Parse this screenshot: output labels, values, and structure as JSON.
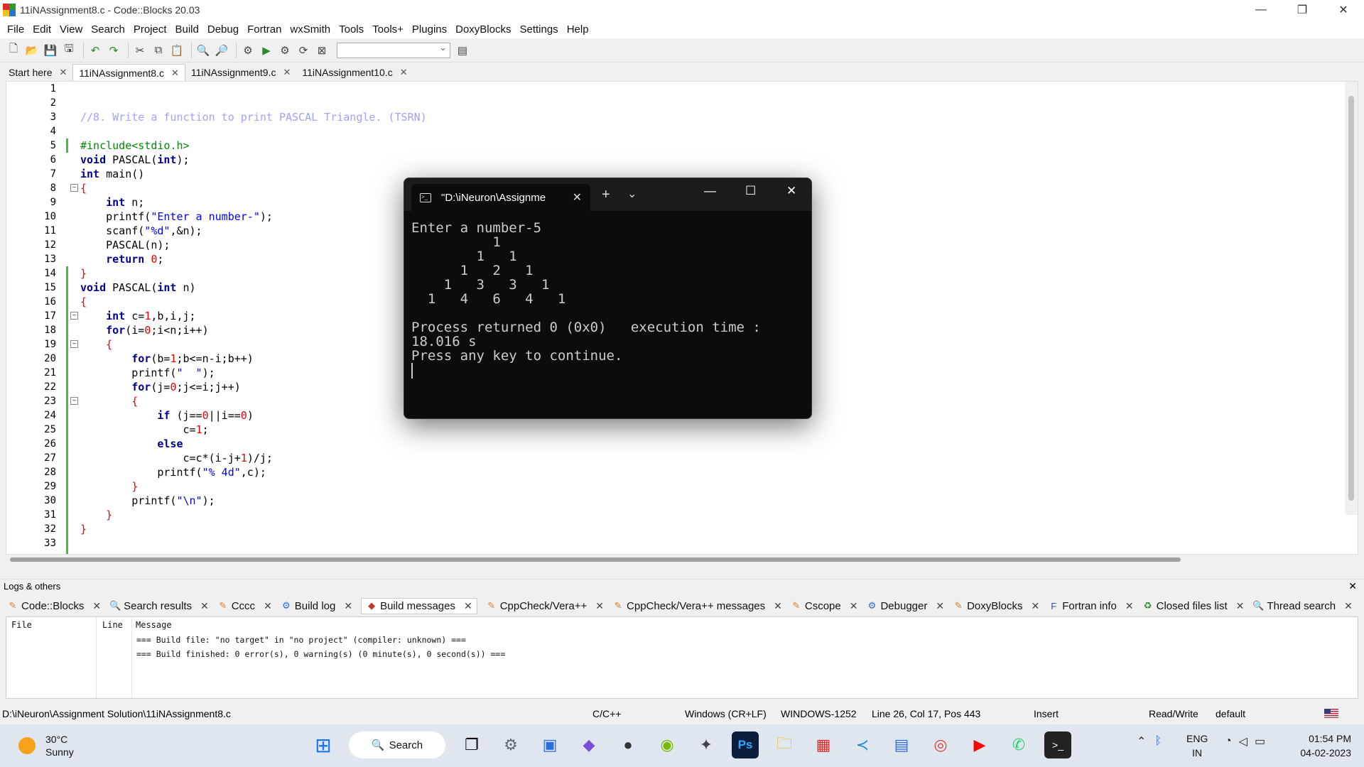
{
  "window": {
    "title": "11iNAssignment8.c - Code::Blocks 20.03",
    "minimize": "—",
    "maximize": "❐",
    "close": "✕"
  },
  "menu": [
    "File",
    "Edit",
    "View",
    "Search",
    "Project",
    "Build",
    "Debug",
    "Fortran",
    "wxSmith",
    "Tools",
    "Tools+",
    "Plugins",
    "DoxyBlocks",
    "Settings",
    "Help"
  ],
  "tabs": [
    {
      "label": "Start here",
      "close": "✕"
    },
    {
      "label": "11iNAssignment8.c",
      "close": "✕"
    },
    {
      "label": "11iNAssignment9.c",
      "close": "✕"
    },
    {
      "label": "11iNAssignment10.c",
      "close": "✕"
    }
  ],
  "editor": {
    "line_numbers": [
      "1",
      "2",
      "3",
      "4",
      "5",
      "6",
      "7",
      "8",
      "9",
      "10",
      "11",
      "12",
      "13",
      "14",
      "15",
      "16",
      "17",
      "18",
      "19",
      "20",
      "21",
      "22",
      "23",
      "24",
      "25",
      "26",
      "27",
      "28",
      "29",
      "30",
      "31",
      "32",
      "33"
    ],
    "lines": [
      "",
      "",
      "//8. Write a function to print PASCAL Triangle. (TSRN)",
      "",
      "#include<stdio.h>",
      "void PASCAL(int);",
      "int main()",
      "{",
      "    int n;",
      "    printf(\"Enter a number-\");",
      "    scanf(\"%d\",&n);",
      "    PASCAL(n);",
      "    return 0;",
      "}",
      "void PASCAL(int n)",
      "{",
      "    int c=1,b,i,j;",
      "    for(i=0;i<n;i++)",
      "    {",
      "        for(b=1;b<=n-i;b++)",
      "        printf(\"  \");",
      "        for(j=0;j<=i;j++)",
      "        {",
      "            if (j==0||i==0)",
      "                c=1;",
      "            else",
      "                c=c*(i-j+1)/j;",
      "            printf(\"% 4d\",c);",
      "        }",
      "        printf(\"\\n\");",
      "    }",
      "}",
      ""
    ]
  },
  "terminal": {
    "tab_title": "\"D:\\iNeuron\\Assignme",
    "tab_close": "✕",
    "new_tab": "+",
    "dropdown": "⌄",
    "min": "—",
    "max": "☐",
    "close": "✕",
    "output": [
      "Enter a number-5",
      "          1",
      "        1   1",
      "      1   2   1",
      "    1   3   3   1",
      "  1   4   6   4   1",
      "",
      "Process returned 0 (0x0)   execution time :",
      "18.016 s",
      "Press any key to continue."
    ]
  },
  "logs": {
    "header": "Logs & others",
    "close": "✕",
    "tabs": [
      "Code::Blocks",
      "Search results",
      "Cccc",
      "Build log",
      "Build messages",
      "CppCheck/Vera++",
      "CppCheck/Vera++ messages",
      "Cscope",
      "Debugger",
      "DoxyBlocks",
      "Fortran info",
      "Closed files list",
      "Thread search"
    ],
    "tab_close": "✕",
    "columns": [
      "File",
      "Line",
      "Message"
    ],
    "messages": [
      "=== Build file: \"no target\" in \"no project\" (compiler: unknown) ===",
      "=== Build finished: 0 error(s), 0 warning(s) (0 minute(s), 0 second(s)) ==="
    ]
  },
  "status": {
    "path": "D:\\iNeuron\\Assignment Solution\\11iNAssignment8.c",
    "language": "C/C++",
    "eol": "Windows (CR+LF)",
    "encoding": "WINDOWS-1252",
    "position": "Line 26, Col 17, Pos 443",
    "mode": "Insert",
    "access": "Read/Write",
    "profile": "default"
  },
  "taskbar": {
    "temperature": "30°C",
    "condition": "Sunny",
    "search": "Search",
    "lang1": "ENG",
    "lang2": "IN",
    "time": "01:54 PM",
    "date": "04-02-2023"
  }
}
